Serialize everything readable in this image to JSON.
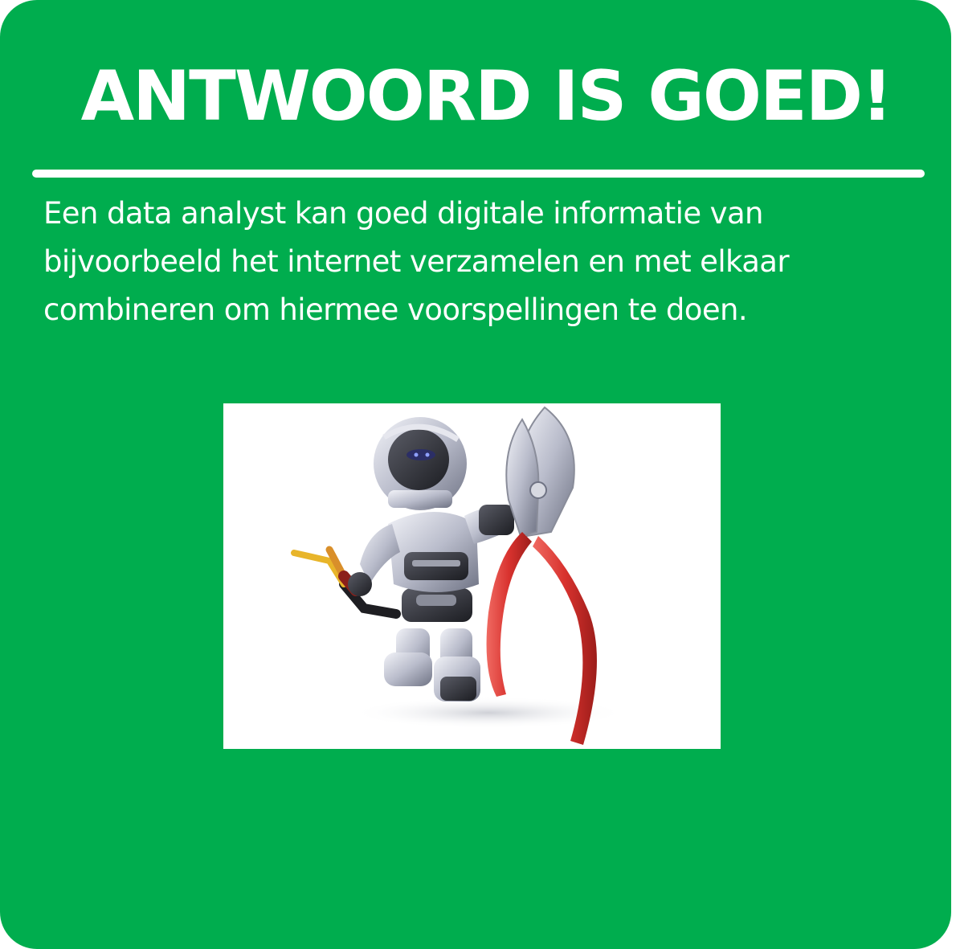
{
  "slide": {
    "title": "ANTWOORD IS GOED!",
    "body_lines": [
      "Een data analyst kan goed digitale informatie van",
      "bijvoorbeeld het internet verzamelen en met elkaar",
      "combineren om hiermee voorspellingen te doen."
    ],
    "background_color": "#00ad4e",
    "text_color": "#ffffff"
  },
  "illustration": {
    "subject": "robot-holding-pliers-and-cable",
    "handle_color": "#d8322e"
  }
}
